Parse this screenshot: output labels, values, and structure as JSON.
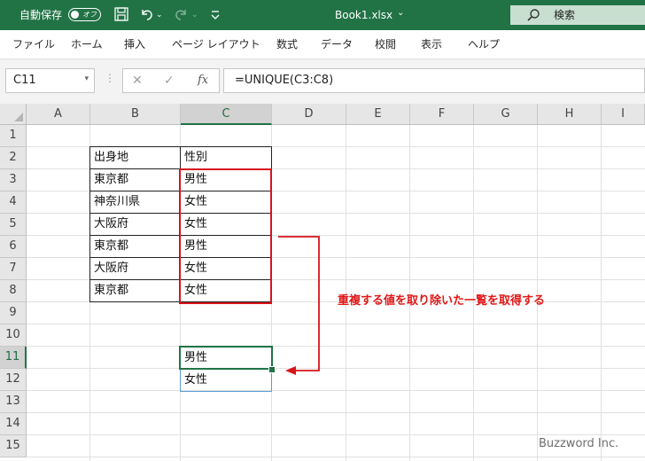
{
  "colors": {
    "brand": "#217346",
    "annotation": "#e01818",
    "highlight_box": "#d7141a",
    "search_bg": "#c8dfd0"
  },
  "titlebar": {
    "autosave_label": "自動保存",
    "autosave_state": "オフ",
    "filename": "Book1.xlsx",
    "filename_chevron": "⌄",
    "qa_more": "⌄",
    "search_placeholder": "検索",
    "icons": [
      "save-icon",
      "undo-icon",
      "redo-icon",
      "customize-qat-icon",
      "search-icon"
    ]
  },
  "menu": [
    "ファイル",
    "ホーム",
    "挿入",
    "ページ レイアウト",
    "数式",
    "データ",
    "校閲",
    "表示",
    "ヘルプ"
  ],
  "formula_bar": {
    "name_box": "C11",
    "name_box_chevron": "▾",
    "separator": "⋮",
    "cancel": "✕",
    "enter": "✓",
    "fx": "fx",
    "formula": "=UNIQUE(C3:C8)"
  },
  "sheet": {
    "columns": [
      "A",
      "B",
      "C",
      "D",
      "E",
      "F",
      "G",
      "H",
      "I"
    ],
    "rows": [
      "1",
      "2",
      "3",
      "4",
      "5",
      "6",
      "7",
      "8",
      "9",
      "10",
      "11",
      "12",
      "13",
      "14",
      "15"
    ],
    "active_cell": "C11",
    "table": {
      "headers": [
        "出身地",
        "性別"
      ],
      "rows": [
        [
          "東京都",
          "男性"
        ],
        [
          "神奈川県",
          "女性"
        ],
        [
          "大阪府",
          "女性"
        ],
        [
          "東京都",
          "男性"
        ],
        [
          "大阪府",
          "女性"
        ],
        [
          "東京都",
          "女性"
        ]
      ]
    },
    "result": [
      "男性",
      "女性"
    ]
  },
  "annotation": "重複する値を取り除いた一覧を取得する",
  "watermark": "Buzzword Inc."
}
